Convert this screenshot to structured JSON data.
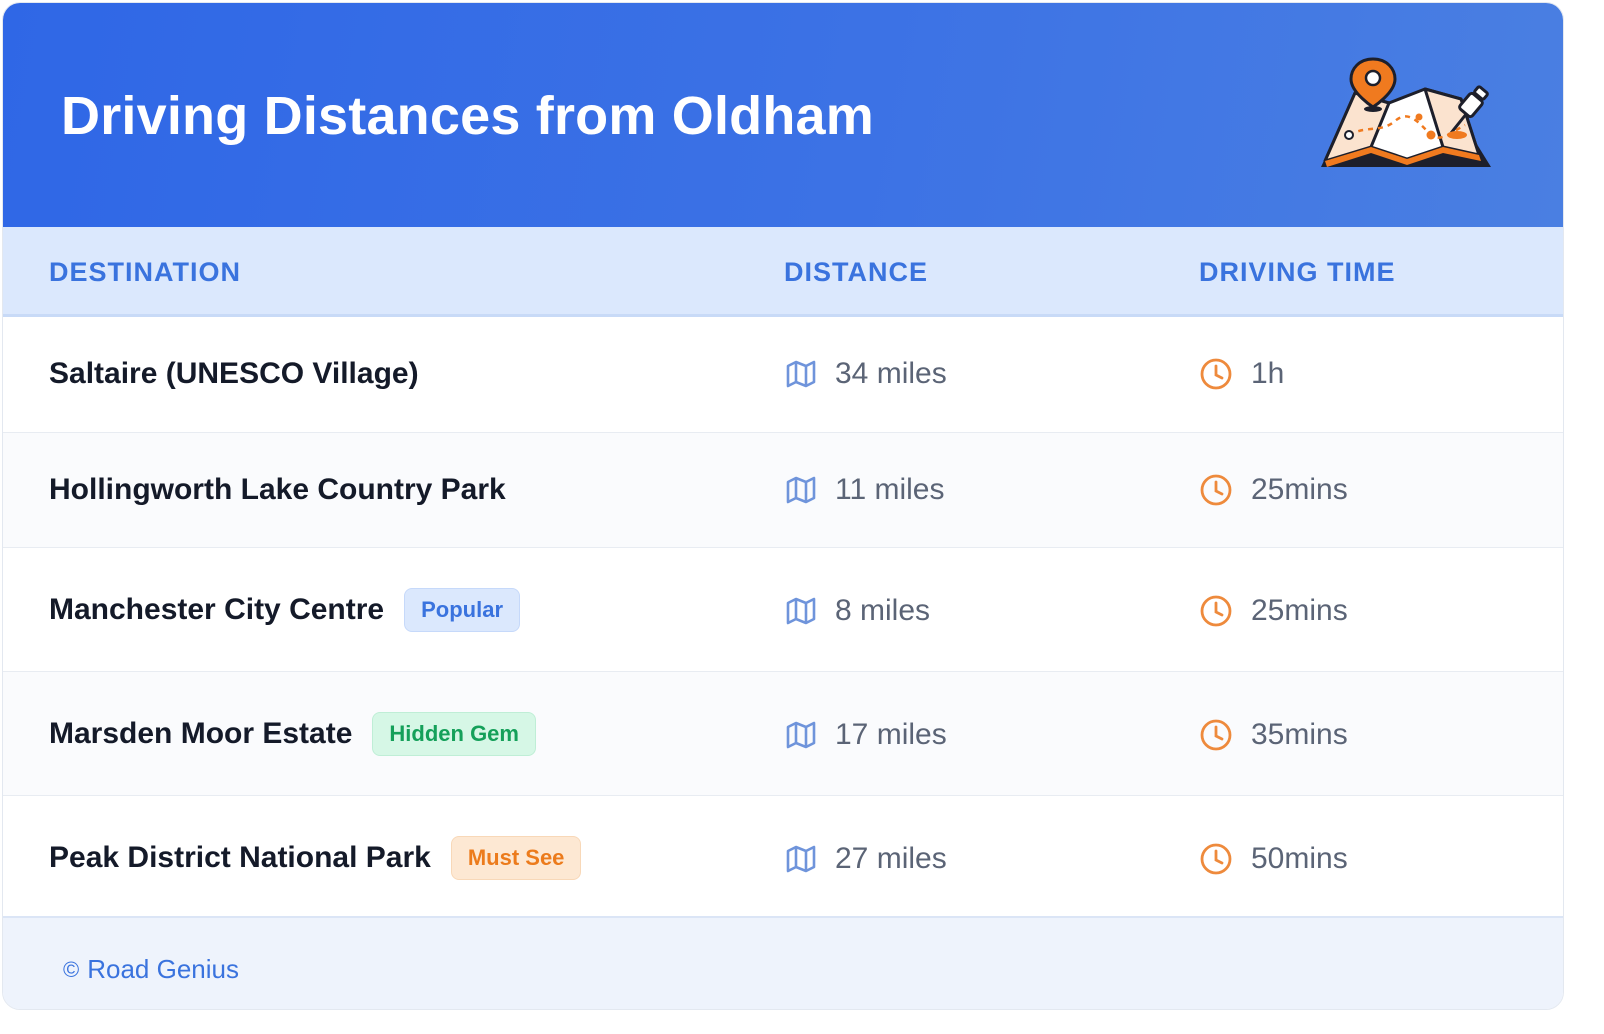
{
  "header": {
    "title": "Driving Distances from Oldham",
    "illustration": "map-with-pins-icon"
  },
  "table": {
    "columns": [
      "DESTINATION",
      "DISTANCE",
      "DRIVING TIME"
    ],
    "rows": [
      {
        "destination": "Saltaire (UNESCO Village)",
        "badge": null,
        "distance": "34 miles",
        "time": "1h"
      },
      {
        "destination": "Hollingworth Lake Country Park",
        "badge": null,
        "distance": "11 miles",
        "time": "25mins"
      },
      {
        "destination": "Manchester City Centre",
        "badge": "Popular",
        "distance": "8 miles",
        "time": "25mins"
      },
      {
        "destination": "Marsden Moor Estate",
        "badge": "Hidden Gem",
        "distance": "17 miles",
        "time": "35mins"
      },
      {
        "destination": "Peak District National Park",
        "badge": "Must See",
        "distance": "27 miles",
        "time": "50mins"
      }
    ],
    "icons": {
      "distance": "map-icon",
      "time": "clock-icon"
    }
  },
  "footer": {
    "copyright_symbol": "©",
    "brand": "Road Genius"
  },
  "colors": {
    "header_gradient_start": "#2f67e6",
    "header_gradient_end": "#4a7fe2",
    "accent_blue": "#3a73de",
    "clock_orange": "#ee8a3c",
    "badge_popular": "#3a73de",
    "badge_hidden_gem": "#15a05a",
    "badge_must_see": "#ec7b1c"
  }
}
